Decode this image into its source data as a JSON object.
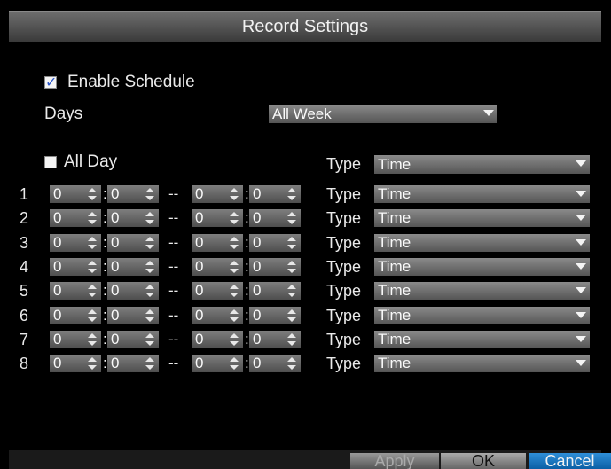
{
  "dialog": {
    "title": "Record Settings"
  },
  "enable_schedule": {
    "label": "Enable Schedule",
    "checked": true
  },
  "days": {
    "label": "Days",
    "value": "All Week"
  },
  "all_day": {
    "label": "All Day",
    "checked": false,
    "type_label": "Type",
    "type_value": "Time"
  },
  "time_rows": [
    {
      "num": "1",
      "sh": "0",
      "sm": "0",
      "eh": "0",
      "em": "0",
      "type_label": "Type",
      "type": "Time"
    },
    {
      "num": "2",
      "sh": "0",
      "sm": "0",
      "eh": "0",
      "em": "0",
      "type_label": "Type",
      "type": "Time"
    },
    {
      "num": "3",
      "sh": "0",
      "sm": "0",
      "eh": "0",
      "em": "0",
      "type_label": "Type",
      "type": "Time"
    },
    {
      "num": "4",
      "sh": "0",
      "sm": "0",
      "eh": "0",
      "em": "0",
      "type_label": "Type",
      "type": "Time"
    },
    {
      "num": "5",
      "sh": "0",
      "sm": "0",
      "eh": "0",
      "em": "0",
      "type_label": "Type",
      "type": "Time"
    },
    {
      "num": "6",
      "sh": "0",
      "sm": "0",
      "eh": "0",
      "em": "0",
      "type_label": "Type",
      "type": "Time"
    },
    {
      "num": "7",
      "sh": "0",
      "sm": "0",
      "eh": "0",
      "em": "0",
      "type_label": "Type",
      "type": "Time"
    },
    {
      "num": "8",
      "sh": "0",
      "sm": "0",
      "eh": "0",
      "em": "0",
      "type_label": "Type",
      "type": "Time"
    }
  ],
  "buttons": {
    "apply": "Apply",
    "ok": "OK",
    "cancel": "Cancel"
  },
  "colors": {
    "accent": "#2b56c9",
    "cancel_button": "#1a7ac4",
    "title_bar": "#555555"
  }
}
